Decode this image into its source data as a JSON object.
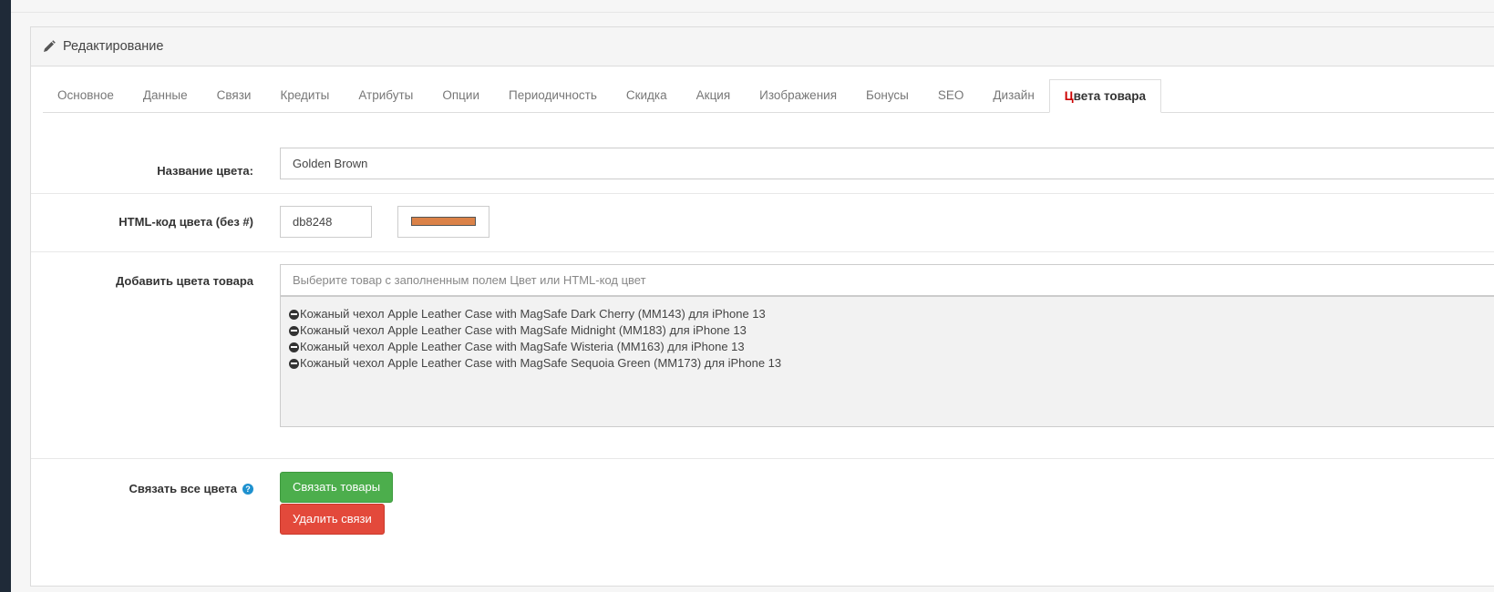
{
  "panel": {
    "heading": "Редактирование"
  },
  "tabs": [
    {
      "label": "Основное"
    },
    {
      "label": "Данные"
    },
    {
      "label": "Связи"
    },
    {
      "label": "Кредиты"
    },
    {
      "label": "Атрибуты"
    },
    {
      "label": "Опции"
    },
    {
      "label": "Периодичность"
    },
    {
      "label": "Скидка"
    },
    {
      "label": "Акция"
    },
    {
      "label": "Изображения"
    },
    {
      "label": "Бонусы"
    },
    {
      "label": "SEO"
    },
    {
      "label": "Дизайн"
    },
    {
      "label_first": "Ц",
      "label_rest": "вета товара",
      "active": true
    }
  ],
  "form": {
    "color_name": {
      "label": "Название цвета:",
      "value": "Golden Brown"
    },
    "html_code": {
      "label": "HTML-код цвета (без #)",
      "value": "db8248",
      "swatch_color": "#db8248"
    },
    "add_colors": {
      "label": "Добавить цвета товара",
      "placeholder": "Выберите товар с заполненным полем Цвет или HTML-код цвет",
      "products": [
        "Кожаный чехол Apple Leather Case with MagSafe Dark Cherry (MM143) для iPhone 13",
        "Кожаный чехол Apple Leather Case with MagSafe Midnight (MM183) для iPhone 13",
        "Кожаный чехол Apple Leather Case with MagSafe Wisteria (MM163) для iPhone 13",
        "Кожаный чехол Apple Leather Case with MagSafe Sequoia Green (MM173) для iPhone 13"
      ]
    },
    "link_all": {
      "label": "Связать все цвета",
      "help_icon": "?",
      "link_button": "Связать товары",
      "unlink_button": "Удалить связи"
    }
  },
  "colors": {
    "green": "#4cae4c",
    "red": "#e3493b",
    "active_tab_accent": "#cc0000",
    "help": "#1e91cf"
  }
}
